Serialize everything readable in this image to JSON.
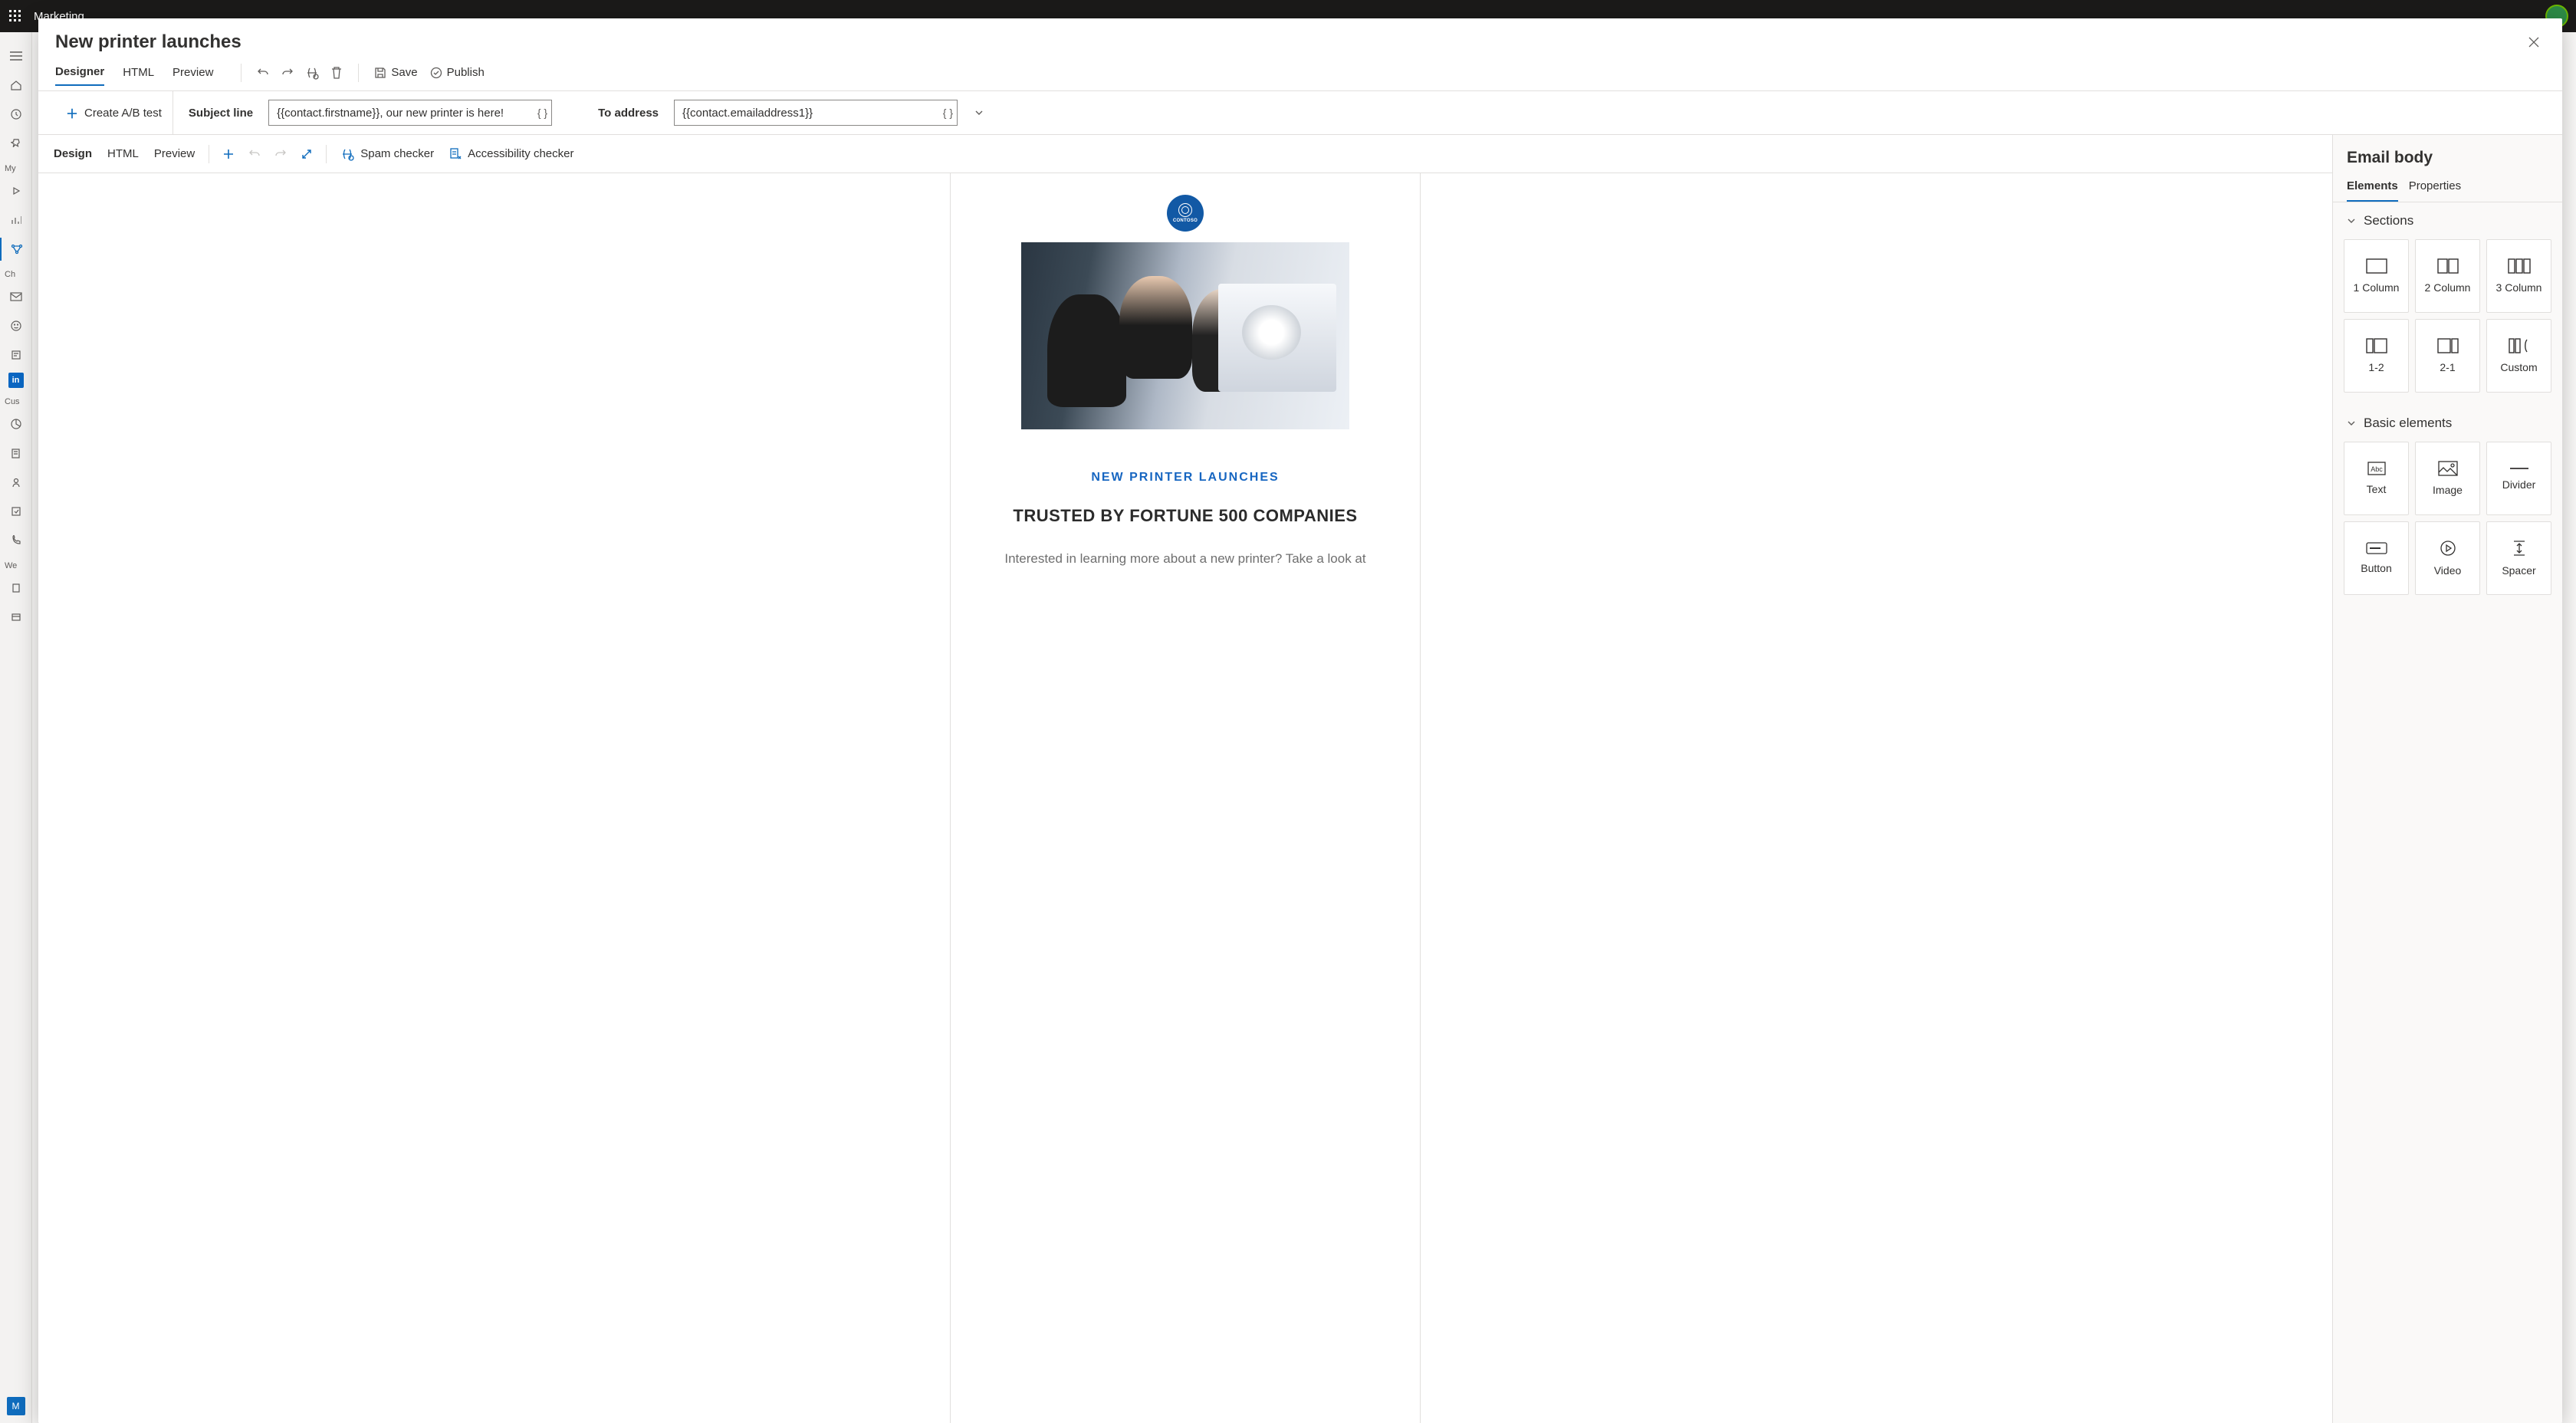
{
  "top_bar": {
    "app_name": "Marketing"
  },
  "rail": {
    "group1": "My",
    "group2": "Ch",
    "group3": "Cus",
    "group4": "We",
    "marketing_badge": "M"
  },
  "modal": {
    "title": "New printer launches",
    "tabs": {
      "designer": "Designer",
      "html": "HTML",
      "preview": "Preview"
    },
    "actions": {
      "save": "Save",
      "publish": "Publish"
    },
    "ab_test": "Create A/B test",
    "subject_label": "Subject line",
    "subject_value": "{{contact.firstname}}, our new printer is here!",
    "to_label": "To address",
    "to_value": "{{contact.emailaddress1}}"
  },
  "ribbon2": {
    "design": "Design",
    "html": "HTML",
    "preview": "Preview",
    "spam": "Spam checker",
    "accessibility": "Accessibility checker"
  },
  "canvas": {
    "logo_text": "CONTOSO",
    "kicker": "NEW PRINTER LAUNCHES",
    "headline": "TRUSTED BY FORTUNE 500 COMPANIES",
    "body": "Interested in learning more about a new printer? Take a look at"
  },
  "side": {
    "title": "Email body",
    "tabs": {
      "elements": "Elements",
      "properties": "Properties"
    },
    "sections_label": "Sections",
    "basic_label": "Basic elements",
    "sections": {
      "col1": "1 Column",
      "col2": "2 Column",
      "col3": "3 Column",
      "c12": "1-2",
      "c21": "2-1",
      "custom": "Custom"
    },
    "basic": {
      "text": "Text",
      "image": "Image",
      "divider": "Divider",
      "button": "Button",
      "video": "Video",
      "spacer": "Spacer"
    }
  }
}
